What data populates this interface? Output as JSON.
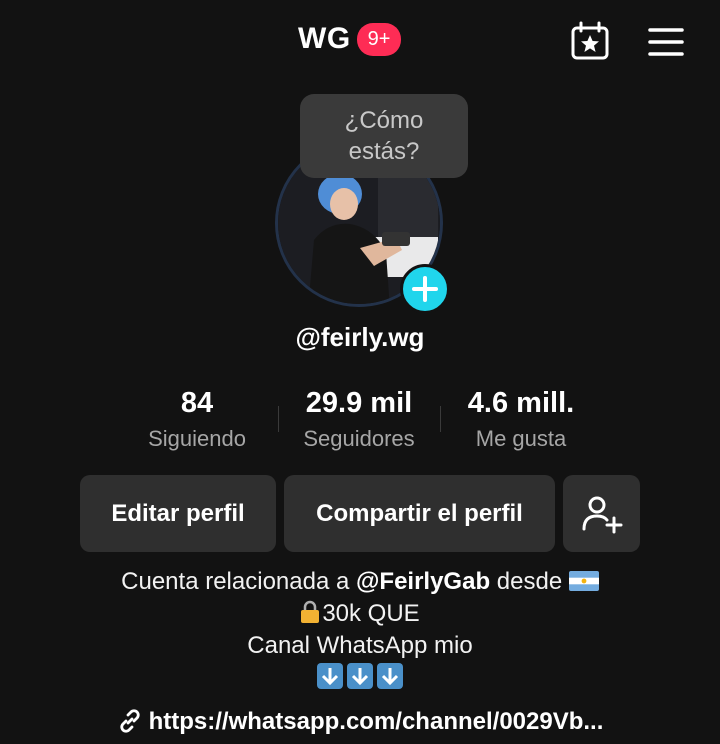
{
  "header": {
    "title": "WG",
    "notifications_badge": "9+",
    "calendar_icon": "calendar-star-icon",
    "menu_icon": "hamburger-menu-icon"
  },
  "avatar": {
    "bubble_text": "¿Cómo estás?",
    "add_icon": "plus-icon"
  },
  "profile": {
    "username": "@feirly.wg"
  },
  "stats": [
    {
      "value": "84",
      "label": "Siguiendo"
    },
    {
      "value": "29.9 mil",
      "label": "Seguidores"
    },
    {
      "value": "4.6 mill.",
      "label": "Me gusta"
    }
  ],
  "actions": {
    "edit_label": "Editar perfil",
    "share_label": "Compartir el perfil",
    "add_friend_icon": "add-user-icon"
  },
  "bio": {
    "line1_prefix": "Cuenta relacionada a ",
    "line1_account": "@FeirlyGab",
    "line1_suffix": " desde ",
    "line2_text": "30k QUE",
    "line3": "Canal WhatsApp mio",
    "link": "https://whatsapp.com/channel/0029Vb..."
  },
  "colors": {
    "background": "#121212",
    "badge": "#fe2c55",
    "add_button": "#20d5ec",
    "button_bg": "#2f2f2f",
    "secondary_text": "#a6a6a6"
  }
}
